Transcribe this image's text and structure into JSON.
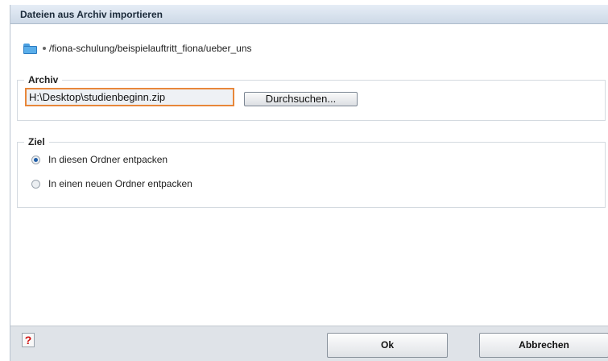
{
  "dialog": {
    "title": "Dateien aus Archiv importieren",
    "path": "/fiona-schulung/beispielauftritt_fiona/ueber_uns"
  },
  "archive": {
    "legend": "Archiv",
    "file_value": "H:\\Desktop\\studienbeginn.zip",
    "browse_label": "Durchsuchen..."
  },
  "target": {
    "legend": "Ziel",
    "options": [
      {
        "label": "In diesen Ordner entpacken",
        "selected": true
      },
      {
        "label": "In einen neuen Ordner entpacken",
        "selected": false
      }
    ]
  },
  "footer": {
    "help_glyph": "?",
    "ok_label": "Ok",
    "cancel_label": "Abbrechen"
  },
  "colors": {
    "focus_border": "#e8873a",
    "title_bg": "#cdd9e7",
    "help_red": "#d01010"
  },
  "icons": [
    "folder-icon",
    "bullet-icon",
    "help-icon"
  ]
}
